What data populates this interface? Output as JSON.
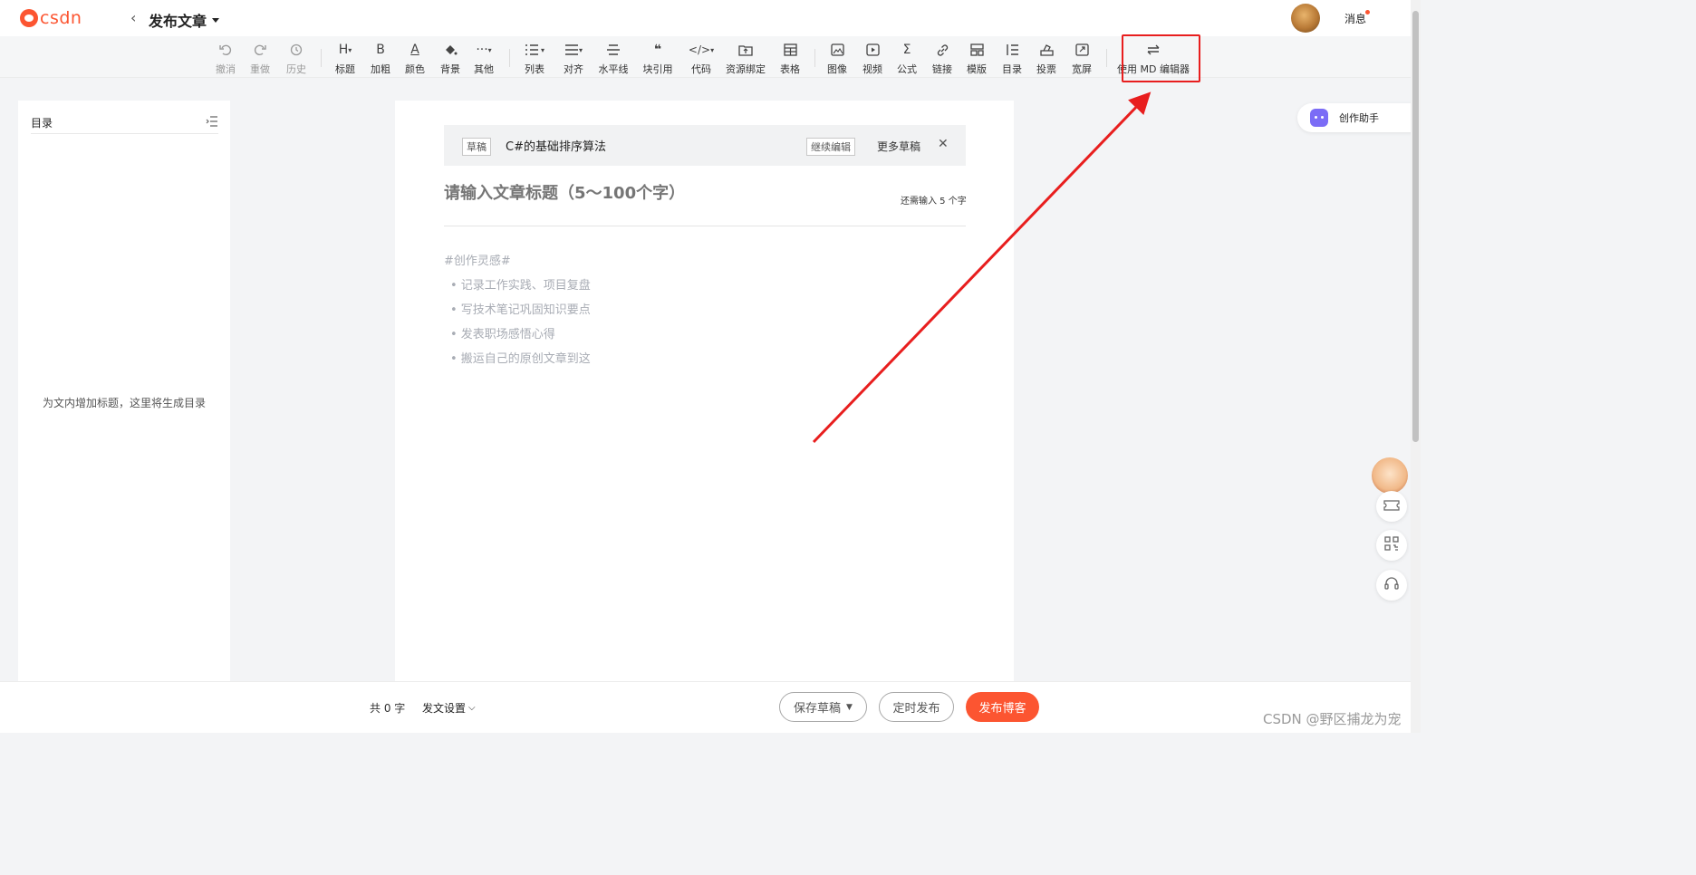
{
  "header": {
    "logo_text": "csdn",
    "page_title": "发布文章",
    "messages_label": "消息"
  },
  "toolbar": {
    "undo": "撤消",
    "redo": "重做",
    "history": "历史",
    "heading": "标题",
    "bold": "加粗",
    "color": "颜色",
    "background": "背景",
    "other": "其他",
    "list": "列表",
    "align": "对齐",
    "hr": "水平线",
    "blockquote": "块引用",
    "code": "代码",
    "resource_bind": "资源绑定",
    "table": "表格",
    "image": "图像",
    "video": "视频",
    "formula": "公式",
    "link": "链接",
    "template": "模版",
    "toc": "目录",
    "vote": "投票",
    "widescreen": "宽屏",
    "use_md_editor": "使用 MD 编辑器",
    "highlight_color": "#e81e1e"
  },
  "toc": {
    "title": "目录",
    "empty_hint": "为文内增加标题，这里将生成目录"
  },
  "draft": {
    "tag": "草稿",
    "name": "C#的基础排序算法",
    "continue_label": "继续编辑",
    "more_label": "更多草稿"
  },
  "editor": {
    "title_placeholder": "请输入文章标题（5～100个字）",
    "remaining_hint": "还需输入 5 个字",
    "inspiration_heading": "#创作灵感#",
    "inspiration_items": [
      "• 记录工作实践、项目复盘",
      "• 写技术笔记巩固知识要点",
      "• 发表职场感悟心得",
      "• 搬运自己的原创文章到这"
    ]
  },
  "right_rail": {
    "assistant_label": "创作助手"
  },
  "bottom": {
    "word_count": "共 0 字",
    "post_settings": "发文设置",
    "save_draft": "保存草稿",
    "schedule": "定时发布",
    "publish": "发布博客"
  },
  "watermark": "CSDN @野区捕龙为宠",
  "colors": {
    "brand": "#fc5531",
    "annotation_red": "#e81e1e"
  }
}
